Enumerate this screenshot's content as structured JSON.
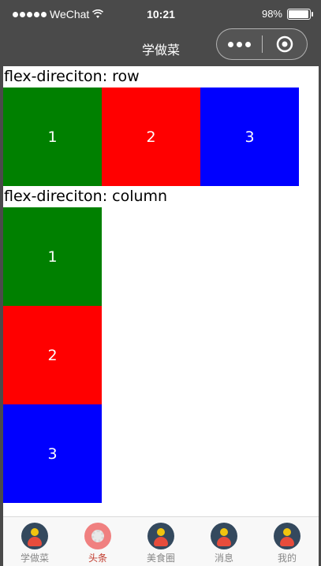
{
  "status_bar": {
    "carrier": "WeChat",
    "time": "10:21",
    "battery_percent": "98%",
    "battery_level": 0.98
  },
  "nav_bar": {
    "title": "学做菜"
  },
  "sections": {
    "row": {
      "label": "flex-direciton: row",
      "items": [
        "1",
        "2",
        "3"
      ]
    },
    "column": {
      "label": "flex-direciton: column",
      "items": [
        "1",
        "2",
        "3"
      ]
    }
  },
  "colors": {
    "item_1": "#008000",
    "item_2": "#ff0000",
    "item_3": "#0000ff",
    "nav_background": "#4a4a4a",
    "tab_active": "#c0392b",
    "tab_inactive": "#888888"
  },
  "tab_bar": {
    "items": [
      {
        "label": "学做菜",
        "icon": "user-avatar-icon",
        "active": false
      },
      {
        "label": "头条",
        "icon": "gear-icon",
        "active": true
      },
      {
        "label": "美食圈",
        "icon": "user-avatar-icon",
        "active": false
      },
      {
        "label": "消息",
        "icon": "user-avatar-icon",
        "active": false
      },
      {
        "label": "我的",
        "icon": "user-avatar-icon",
        "active": false
      }
    ]
  }
}
